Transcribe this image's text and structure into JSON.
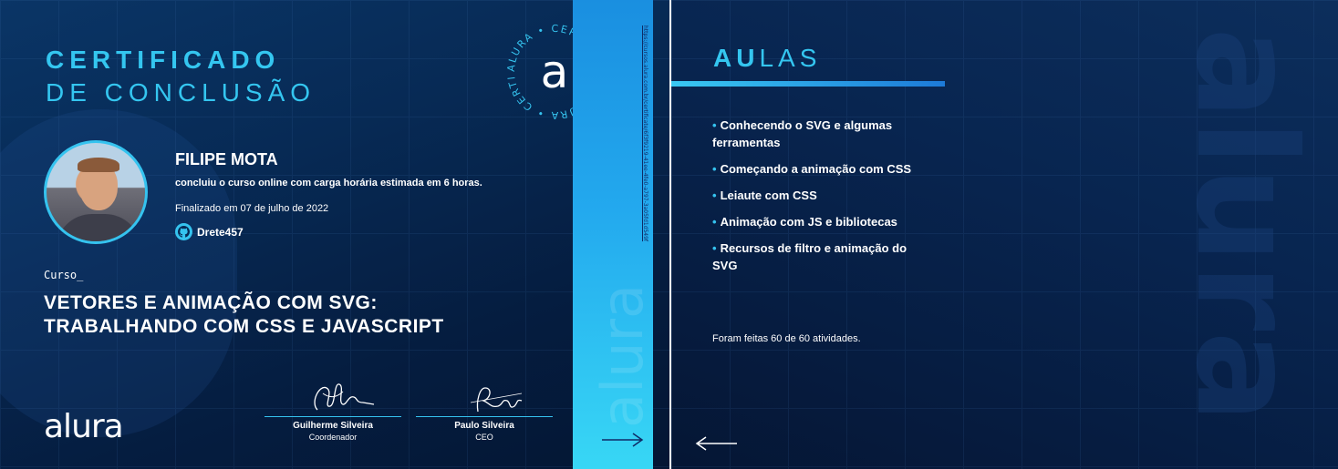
{
  "certificate": {
    "title_bold": "CERTIFICADO",
    "title_light": "DE CONCLUSÃO",
    "seal_text": "ALURA • CERTIFICADO ALURA • CERTIFICADO •",
    "seal_letter": "a",
    "student_name": "FILIPE MOTA",
    "completion_text": "concluiu o curso online com carga horária estimada em 6 horas.",
    "finished_date": "Finalizado em 07 de julho de 2022",
    "github_user": "Drete457",
    "course_label": "Curso_",
    "course_title_line1": "VETORES E ANIMAÇÃO COM SVG:",
    "course_title_line2": "TRABALHANDO COM CSS E JAVASCRIPT",
    "logo": "alura",
    "verification_url": "https://cursos.alura.com.br/certificate/6f3f9219-41ee-4fe0-a797-3a05fd1d549f",
    "strip_watermark": "alura",
    "signatures": [
      {
        "name": "Guilherme Silveira",
        "role": "Coordenador"
      },
      {
        "name": "Paulo Silveira",
        "role": "CEO"
      }
    ]
  },
  "lessons_panel": {
    "title_bold": "AU",
    "title_light": "LAS",
    "lessons": [
      "Conhecendo o SVG e algumas ferramentas",
      "Começando a animação com CSS",
      "Leiaute com CSS",
      "Animação com JS e bibliotecas",
      "Recursos de filtro e animação do SVG"
    ],
    "activities_text": "Foram feitas 60 de 60 atividades.",
    "watermark": "alura"
  },
  "colors": {
    "accent": "#34c6f0",
    "background_dark": "#051d40",
    "strip_top": "#1a8fe0",
    "strip_bottom": "#38d7f5"
  },
  "icons": [
    "github-icon",
    "arrow-right-icon",
    "arrow-left-icon",
    "alura-seal-icon"
  ]
}
